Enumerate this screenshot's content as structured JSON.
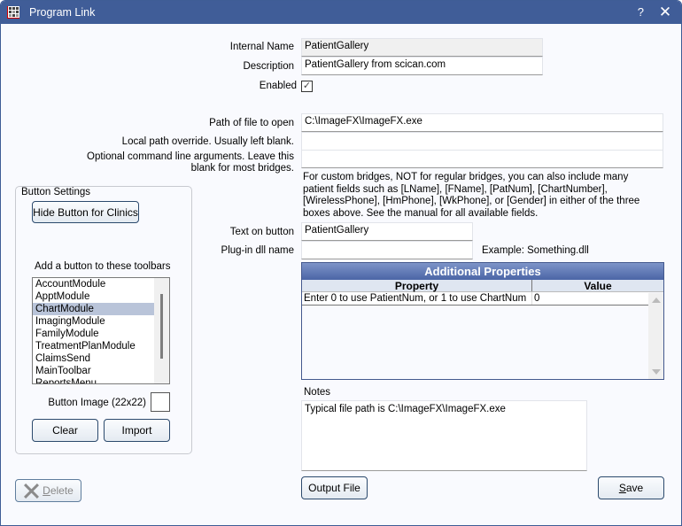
{
  "window": {
    "title": "Program Link",
    "help_label": "?",
    "close_label": "✕"
  },
  "fields": {
    "internal_name": {
      "label": "Internal Name",
      "value": "PatientGallery"
    },
    "description": {
      "label": "Description",
      "value": "PatientGallery from scican.com"
    },
    "enabled": {
      "label": "Enabled",
      "checked": true,
      "glyph": "✓"
    },
    "path": {
      "label": "Path of file to open",
      "value": "C:\\ImageFX\\ImageFX.exe"
    },
    "local_override": {
      "label": "Local path override.  Usually left blank.",
      "value": ""
    },
    "cmd_args": {
      "label_line1": "Optional command line arguments.  Leave this",
      "label_line2": "blank for most bridges.",
      "value": ""
    },
    "help_text": "For custom bridges, NOT for regular bridges, you can also include many patient fields such as [LName], [FName], [PatNum], [ChartNumber], [WirelessPhone], [HmPhone], [WkPhone], or [Gender] in either of the three boxes above. See the manual for all available fields.",
    "button_text": {
      "label": "Text on button",
      "value": "PatientGallery"
    },
    "plugin_dll": {
      "label": "Plug-in dll name",
      "value": "",
      "example": "Example: Something.dll"
    }
  },
  "button_settings": {
    "title": "Button Settings",
    "hide_button_label": "Hide Button for Clinics",
    "toolbars_label": "Add a button to these toolbars",
    "toolbars": [
      {
        "label": "AccountModule",
        "selected": false
      },
      {
        "label": "ApptModule",
        "selected": false
      },
      {
        "label": "ChartModule",
        "selected": true
      },
      {
        "label": "ImagingModule",
        "selected": false
      },
      {
        "label": "FamilyModule",
        "selected": false
      },
      {
        "label": "TreatmentPlanModule",
        "selected": false
      },
      {
        "label": "ClaimsSend",
        "selected": false
      },
      {
        "label": "MainToolbar",
        "selected": false
      },
      {
        "label": "ReportsMenu",
        "selected": false
      }
    ],
    "image_label": "Button Image (22x22)",
    "clear_label": "Clear",
    "import_label": "Import"
  },
  "properties_grid": {
    "title": "Additional Properties",
    "columns": [
      "Property",
      "Value"
    ],
    "rows": [
      {
        "property": "Enter 0 to use PatientNum, or 1 to use ChartNum",
        "value": "0"
      }
    ]
  },
  "notes": {
    "label": "Notes",
    "value": "Typical file path is C:\\ImageFX\\ImageFX.exe"
  },
  "footer": {
    "delete_mnemonic": "D",
    "delete_rest": "elete",
    "output_file_label": "Output File",
    "save_mnemonic": "S",
    "save_rest": "ave"
  }
}
